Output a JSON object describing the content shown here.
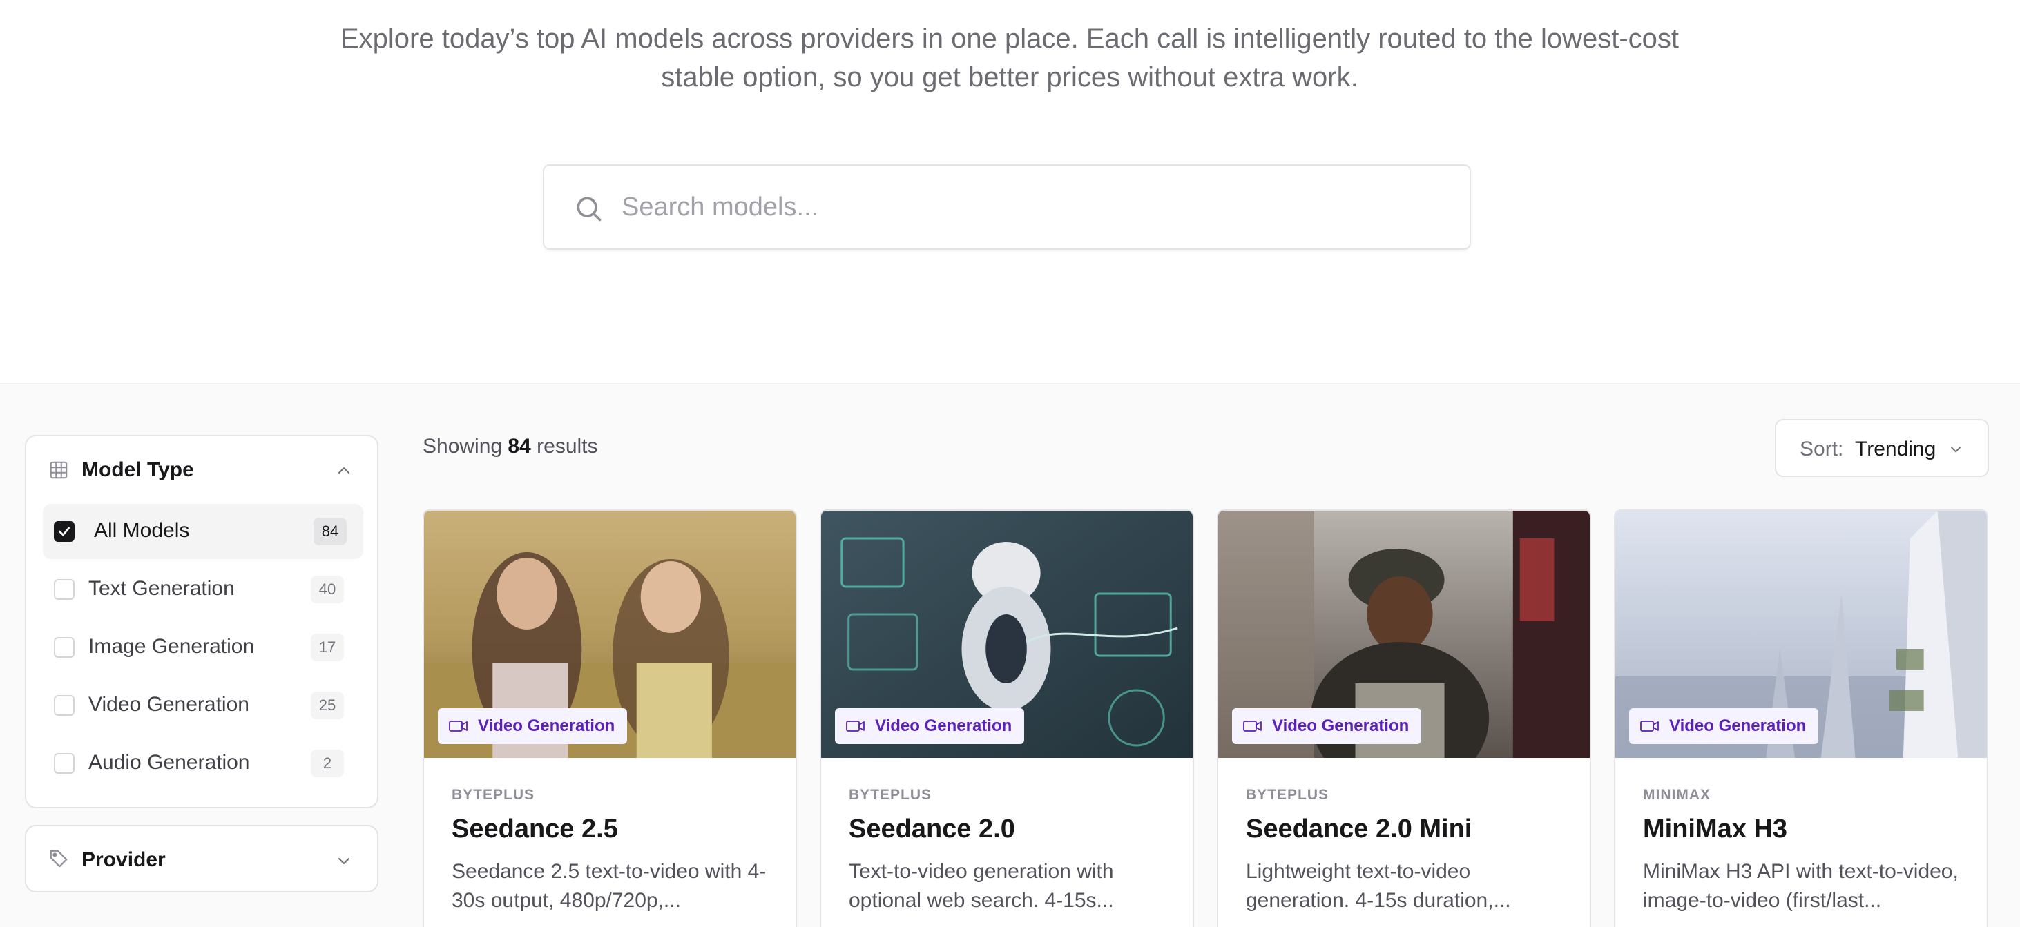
{
  "hero": {
    "subtitle": "Explore today’s top AI models across providers in one place. Each call is intelligently routed to the lowest-cost stable option, so you get better prices without extra work."
  },
  "search": {
    "placeholder": "Search models...",
    "icon": "search-icon"
  },
  "sidebar": {
    "model_type": {
      "title": "Model Type",
      "icon": "grid-icon",
      "items": [
        {
          "label": "All Models",
          "count": "84",
          "checked": true
        },
        {
          "label": "Text Generation",
          "count": "40",
          "checked": false
        },
        {
          "label": "Image Generation",
          "count": "17",
          "checked": false
        },
        {
          "label": "Video Generation",
          "count": "25",
          "checked": false
        },
        {
          "label": "Audio Generation",
          "count": "2",
          "checked": false
        }
      ]
    },
    "provider": {
      "title": "Provider",
      "icon": "tag-icon"
    }
  },
  "results": {
    "prefix": "Showing",
    "count": "84",
    "suffix": "results"
  },
  "sort": {
    "label": "Sort:",
    "value": "Trending"
  },
  "cards": [
    {
      "badge": "Video Generation",
      "provider": "BYTEPLUS",
      "title": "Seedance 2.5",
      "description": "Seedance 2.5 text-to-video with 4-30s output, 480p/720p,..."
    },
    {
      "badge": "Video Generation",
      "provider": "BYTEPLUS",
      "title": "Seedance 2.0",
      "description": "Text-to-video generation with optional web search. 4-15s..."
    },
    {
      "badge": "Video Generation",
      "provider": "BYTEPLUS",
      "title": "Seedance 2.0 Mini",
      "description": "Lightweight text-to-video generation. 4-15s duration,..."
    },
    {
      "badge": "Video Generation",
      "provider": "MINIMAX",
      "title": "MiniMax H3",
      "description": "MiniMax H3 API with text-to-video, image-to-video (first/last..."
    }
  ],
  "colors": {
    "accent_badge_bg": "#f5f3ff",
    "accent_badge_text": "#5b21b6",
    "border": "#e4e4e7",
    "lower_bg": "#fafafa"
  }
}
